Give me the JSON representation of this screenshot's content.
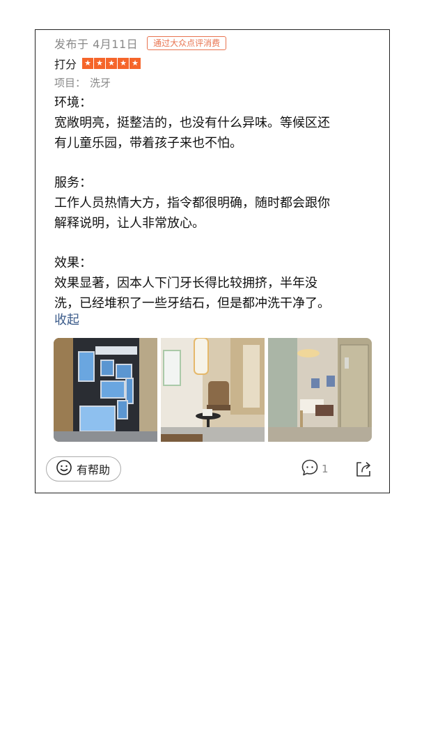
{
  "review": {
    "date": "发布于 4月11日",
    "badge": "通过大众点评消费",
    "rating_label": "打分",
    "rating_stars": 5,
    "project_label": "项目：",
    "project_value": "洗牙",
    "sections": [
      {
        "heading": "环境：",
        "body": "宽敞明亮，挺整洁的，也没有什么异味。等候区还\n有儿童乐园，带着孩子来也不怕。"
      },
      {
        "heading": "服务：",
        "body": "工作人员热情大方，指令都很明确，随时都会跟你\n解释说明，让人非常放心。"
      },
      {
        "heading": "效果：",
        "body": "效果显著，因本人下门牙长得比较拥挤，半年没\n洗，已经堆积了一些牙结石，但是都冲洗干净了。"
      }
    ],
    "collapse_label": "收起"
  },
  "photos": [
    {
      "name": "photo-honor-wall"
    },
    {
      "name": "photo-waiting-area"
    },
    {
      "name": "photo-treatment-room"
    }
  ],
  "actions": {
    "helpful_label": "有帮助",
    "comment_count": "1"
  },
  "colors": {
    "accent": "#f5652a",
    "badge": "#e8734f",
    "link": "#3b5b8a",
    "muted": "#888888"
  }
}
